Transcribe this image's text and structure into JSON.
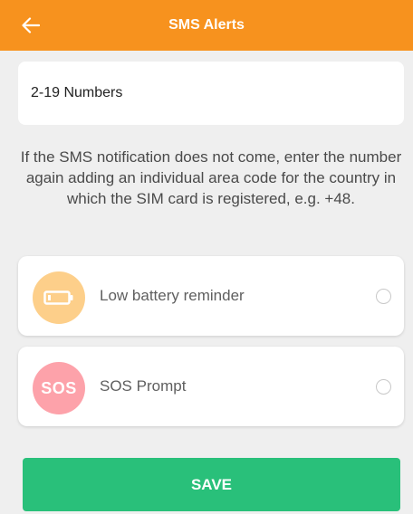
{
  "header": {
    "title": "SMS Alerts",
    "back_icon": "arrow-left-icon",
    "background_color": "#f7921e"
  },
  "numbers": {
    "placeholder": "2-19 Numbers",
    "value": ""
  },
  "note": "If the SMS notification does not come, enter the number again adding an individual area code for the country in which the SIM card is registered, e.g. +48.",
  "options": [
    {
      "label": "Low battery reminder",
      "icon": "battery-icon",
      "icon_color": "#fdcf8a",
      "selected": false
    },
    {
      "label": "SOS Prompt",
      "icon": "sos-icon",
      "icon_text": "SOS",
      "icon_color": "#fda2aa",
      "selected": false
    }
  ],
  "save_button": {
    "label": "SAVE",
    "color": "#29c07a"
  }
}
